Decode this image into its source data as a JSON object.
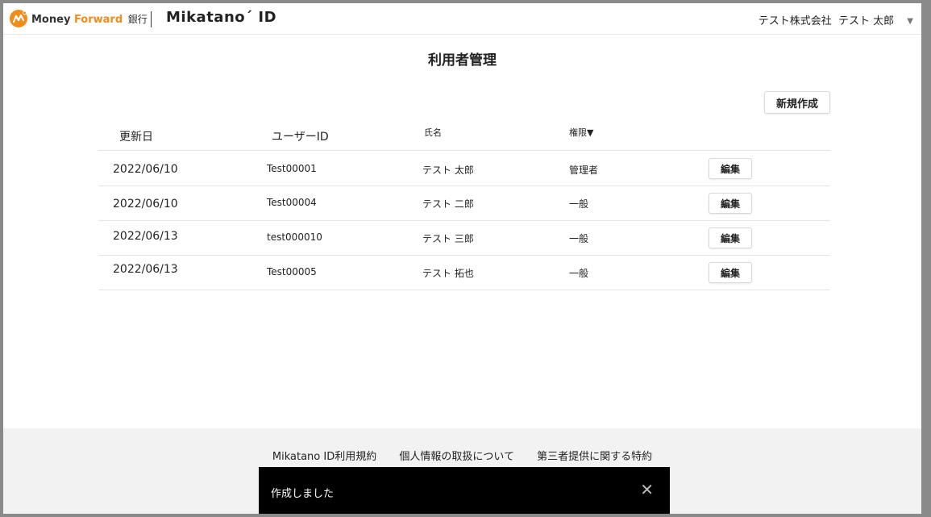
{
  "header": {
    "brand_part1": "Money",
    "brand_part2": "Forward",
    "brand_part3": "銀行",
    "product": "Mikatano",
    "product_mark": "´",
    "product_suffix": "ID",
    "user_menu": "テスト株式会社  テスト 太郎",
    "caret_icon": "chevron-down-icon"
  },
  "page": {
    "title": "利用者管理",
    "new_button": "新規作成"
  },
  "table": {
    "headers": [
      "更新日",
      "ユーザーID",
      "氏名",
      "権限▼"
    ],
    "rows": [
      {
        "date": "2022/06/10",
        "user_id": "Test00001",
        "name": "テスト 太郎",
        "role": "管理者",
        "action": "編集"
      },
      {
        "date": "2022/06/10",
        "user_id": "Test00004",
        "name": "テスト 二郎",
        "role": "一般",
        "action": "編集"
      },
      {
        "date": "2022/06/13",
        "user_id": "test000010",
        "name": "テスト 三郎",
        "role": "一般",
        "action": "編集"
      },
      {
        "date": "2022/06/13",
        "user_id": "Test00005",
        "name": "テスト 拓也",
        "role": "一般",
        "action": "編集"
      }
    ]
  },
  "footer": {
    "links": [
      "Mikatano ID利用規約",
      "個人情報の取扱について",
      "第三者提供に関する特約"
    ]
  },
  "toast": {
    "message": "作成しました",
    "close": "✕"
  },
  "colors": {
    "brand_orange": "#f08c1a",
    "toast_bg": "#000000",
    "footer_bg": "#f2f2f2"
  }
}
